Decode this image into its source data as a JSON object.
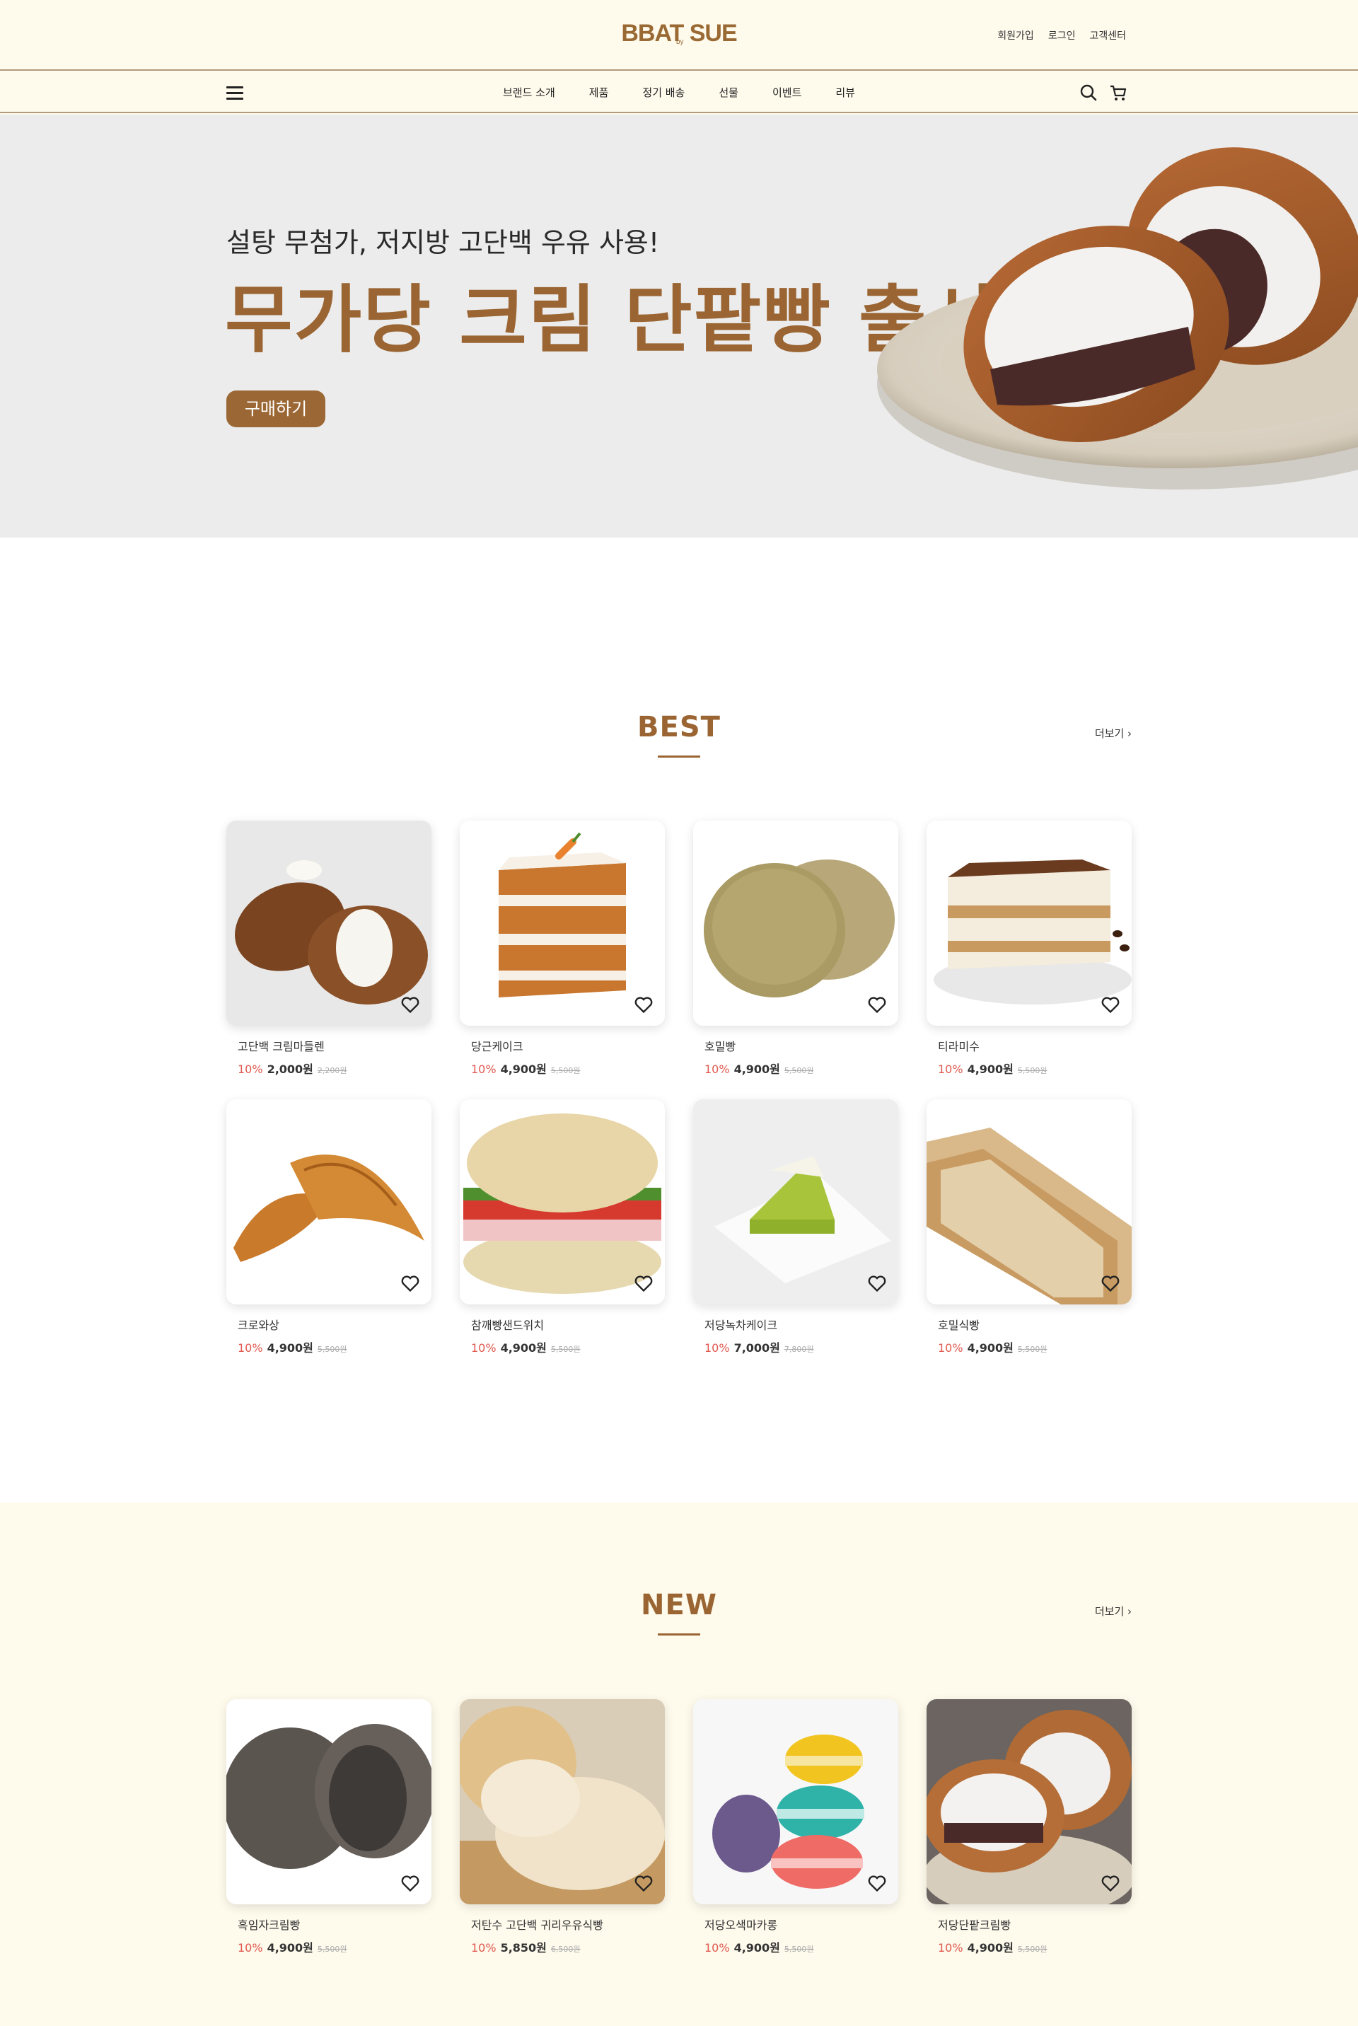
{
  "header": {
    "logo_main": "BBAT SUE",
    "logo_small": "by",
    "util_links": [
      "회원가입",
      "로그인",
      "고객센터"
    ]
  },
  "nav": {
    "menu": [
      "브랜드 소개",
      "제품",
      "정기 배송",
      "선물",
      "이벤트",
      "리뷰"
    ]
  },
  "hero": {
    "subtitle": "설탕 무첨가, 저지방 고단백 우유 사용!",
    "title": "무가당 크림 단팥빵 출시",
    "button": "구매하기"
  },
  "best": {
    "title": "BEST",
    "more": "더보기 ›",
    "products": [
      {
        "name": "고단백 크림마들렌",
        "discount": "10%",
        "price": "2,000원",
        "original": "2,200원",
        "image": "madeleine"
      },
      {
        "name": "당근케이크",
        "discount": "10%",
        "price": "4,900원",
        "original": "5,500원",
        "image": "carrot-cake"
      },
      {
        "name": "호밀빵",
        "discount": "10%",
        "price": "4,900원",
        "original": "5,500원",
        "image": "rye-bread"
      },
      {
        "name": "티라미수",
        "discount": "10%",
        "price": "4,900원",
        "original": "5,500원",
        "image": "tiramisu"
      },
      {
        "name": "크로와상",
        "discount": "10%",
        "price": "4,900원",
        "original": "5,500원",
        "image": "croissant"
      },
      {
        "name": "참깨빵샌드위치",
        "discount": "10%",
        "price": "4,900원",
        "original": "5,500원",
        "image": "sandwich"
      },
      {
        "name": "저당녹차케이크",
        "discount": "10%",
        "price": "7,000원",
        "original": "7,800원",
        "image": "greentea-cake"
      },
      {
        "name": "호밀식빵",
        "discount": "10%",
        "price": "4,900원",
        "original": "5,500원",
        "image": "rye-loaf"
      }
    ]
  },
  "new": {
    "title": "NEW",
    "more": "더보기 ›",
    "products": [
      {
        "name": "흑임자크림빵",
        "discount": "10%",
        "price": "4,900원",
        "original": "5,500원",
        "image": "sesame-cream-bun"
      },
      {
        "name": "저탄수 고단백 귀리우유식빵",
        "discount": "10%",
        "price": "5,850원",
        "original": "6,500원",
        "image": "oat-milk-bread"
      },
      {
        "name": "저당오색마카롱",
        "discount": "10%",
        "price": "4,900원",
        "original": "5,500원",
        "image": "macarons"
      },
      {
        "name": "저당단팥크림빵",
        "discount": "10%",
        "price": "4,900원",
        "original": "5,500원",
        "image": "redbean-cream-bun"
      }
    ]
  },
  "colors": {
    "brand": "#9a6532",
    "cream_bg": "#fefaec",
    "discount": "#e05a4f"
  }
}
